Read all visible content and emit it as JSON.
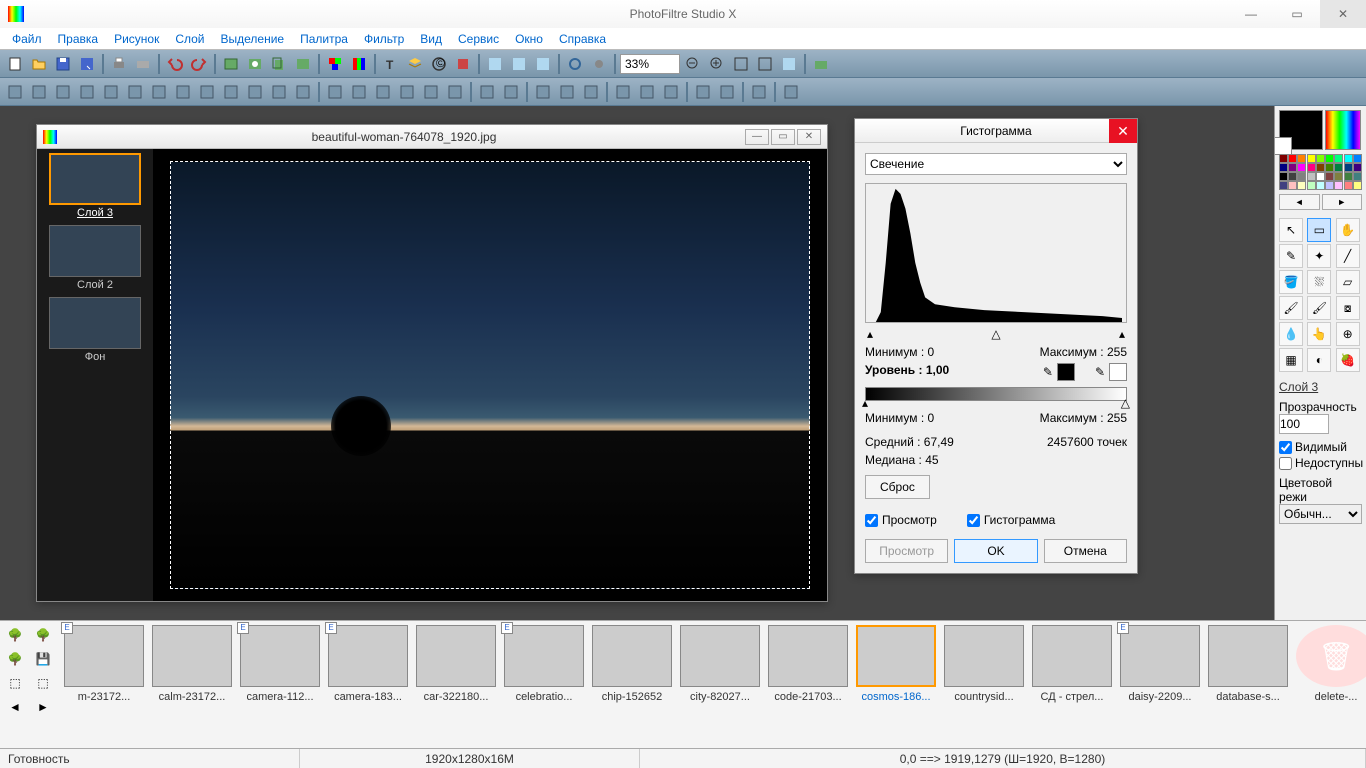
{
  "app": {
    "title": "PhotoFiltre Studio X"
  },
  "menu": [
    "Файл",
    "Правка",
    "Рисунок",
    "Слой",
    "Выделение",
    "Палитра",
    "Фильтр",
    "Вид",
    "Сервис",
    "Окно",
    "Справка"
  ],
  "toolbar": {
    "zoom": "33%"
  },
  "document": {
    "filename": "beautiful-woman-764078_1920.jpg",
    "layers": [
      {
        "name": "Слой 3",
        "selected": true
      },
      {
        "name": "Слой 2",
        "selected": false
      },
      {
        "name": "Фон",
        "selected": false
      }
    ]
  },
  "histogram": {
    "title": "Гистограмма",
    "channel": "Свечение",
    "min_label": "Минимум : 0",
    "max_label": "Максимум : 255",
    "level_label": "Уровень : 1,00",
    "min_label2": "Минимум : 0",
    "max_label2": "Максимум : 255",
    "mean": "Средний : 67,49",
    "median": "Медиана : 45",
    "points": "2457600 точек",
    "reset": "Сброс",
    "preview_check": "Просмотр",
    "hist_check": "Гистограмма",
    "preview_btn": "Просмотр",
    "ok": "OK",
    "cancel": "Отмена"
  },
  "rightpanel": {
    "layer_label": "Слой 3",
    "opacity_label": "Прозрачность",
    "opacity_value": "100",
    "visible": "Видимый",
    "locked": "Недоступны",
    "colormode_label": "Цветовой режи",
    "colormode_value": "Обычн..."
  },
  "filmstrip": [
    {
      "label": "m-23172...",
      "selected": false,
      "badge": true
    },
    {
      "label": "calm-23172...",
      "selected": false
    },
    {
      "label": "camera-112...",
      "selected": false,
      "badge": true
    },
    {
      "label": "camera-183...",
      "selected": false,
      "badge": true
    },
    {
      "label": "car-322180...",
      "selected": false
    },
    {
      "label": "celebratio...",
      "selected": false,
      "badge": true
    },
    {
      "label": "chip-152652",
      "selected": false
    },
    {
      "label": "city-82027...",
      "selected": false
    },
    {
      "label": "code-21703...",
      "selected": false
    },
    {
      "label": "cosmos-186...",
      "selected": true
    },
    {
      "label": "countrysid...",
      "selected": false
    },
    {
      "label": "СД - стрел...",
      "selected": false
    },
    {
      "label": "daisy-2209...",
      "selected": false,
      "badge": true
    },
    {
      "label": "database-s...",
      "selected": false
    },
    {
      "label": "delete-...",
      "selected": false,
      "delete": true
    }
  ],
  "status": {
    "ready": "Готовность",
    "dims": "1920x1280x16M",
    "coords": "0,0 ==> 1919,1279 (Ш=1920, В=1280)"
  },
  "palette_colors": [
    "#800000",
    "#f00",
    "#ff8000",
    "#ff0",
    "#80ff00",
    "#0f0",
    "#00ff80",
    "#0ff",
    "#0080ff",
    "#000080",
    "#800080",
    "#f0f",
    "#ff0080",
    "#804000",
    "#408000",
    "#008040",
    "#004080",
    "#400080",
    "#000",
    "#404040",
    "#808080",
    "#c0c0c0",
    "#fff",
    "#804040",
    "#808040",
    "#408040",
    "#408080",
    "#404080",
    "#ffc0c0",
    "#ffffc0",
    "#c0ffc0",
    "#c0ffff",
    "#c0c0ff",
    "#ffc0ff",
    "#ff8080",
    "#ffff80"
  ]
}
